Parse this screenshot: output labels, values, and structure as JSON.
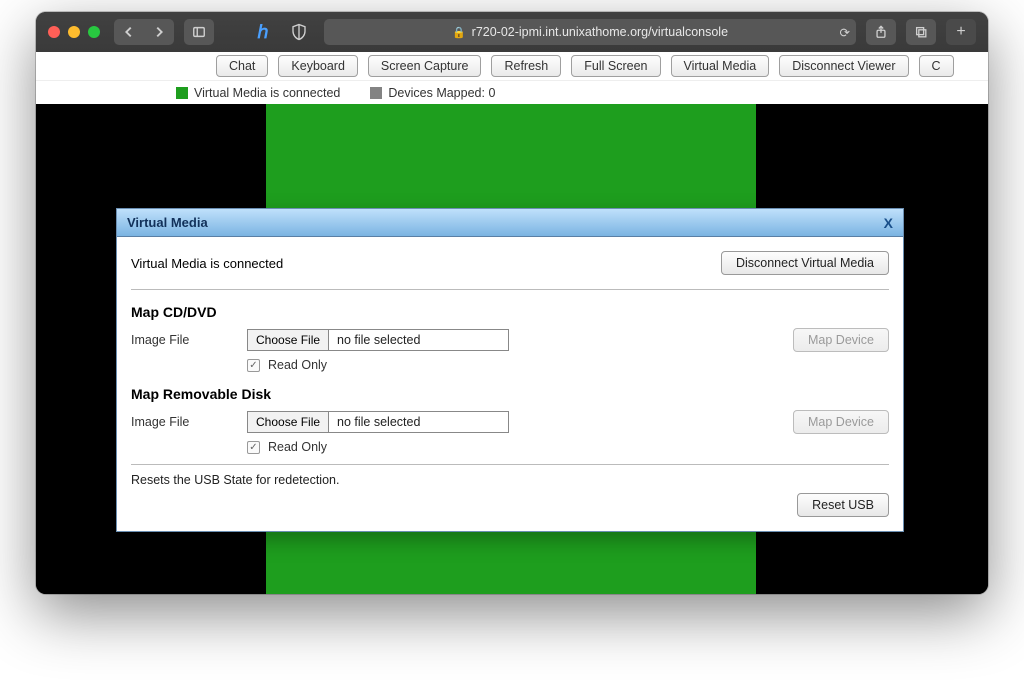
{
  "browser": {
    "url": "r720-02-ipmi.int.unixathome.org/virtualconsole"
  },
  "toolbar": {
    "buttons": [
      "Chat",
      "Keyboard",
      "Screen Capture",
      "Refresh",
      "Full Screen",
      "Virtual Media",
      "Disconnect Viewer",
      "C"
    ]
  },
  "status": {
    "connected_label": "Virtual Media is connected",
    "devices_label": "Devices Mapped: 0"
  },
  "dialog": {
    "title": "Virtual Media",
    "close": "X",
    "status_text": "Virtual Media is connected",
    "disconnect_label": "Disconnect Virtual Media",
    "sections": {
      "cd": {
        "heading": "Map CD/DVD",
        "image_label": "Image File",
        "choose_label": "Choose File",
        "file_text": "no file selected",
        "readonly_label": "Read Only",
        "map_label": "Map Device"
      },
      "rd": {
        "heading": "Map Removable Disk",
        "image_label": "Image File",
        "choose_label": "Choose File",
        "file_text": "no file selected",
        "readonly_label": "Read Only",
        "map_label": "Map Device"
      }
    },
    "reset_text": "Resets the USB State for redetection.",
    "reset_label": "Reset USB"
  }
}
